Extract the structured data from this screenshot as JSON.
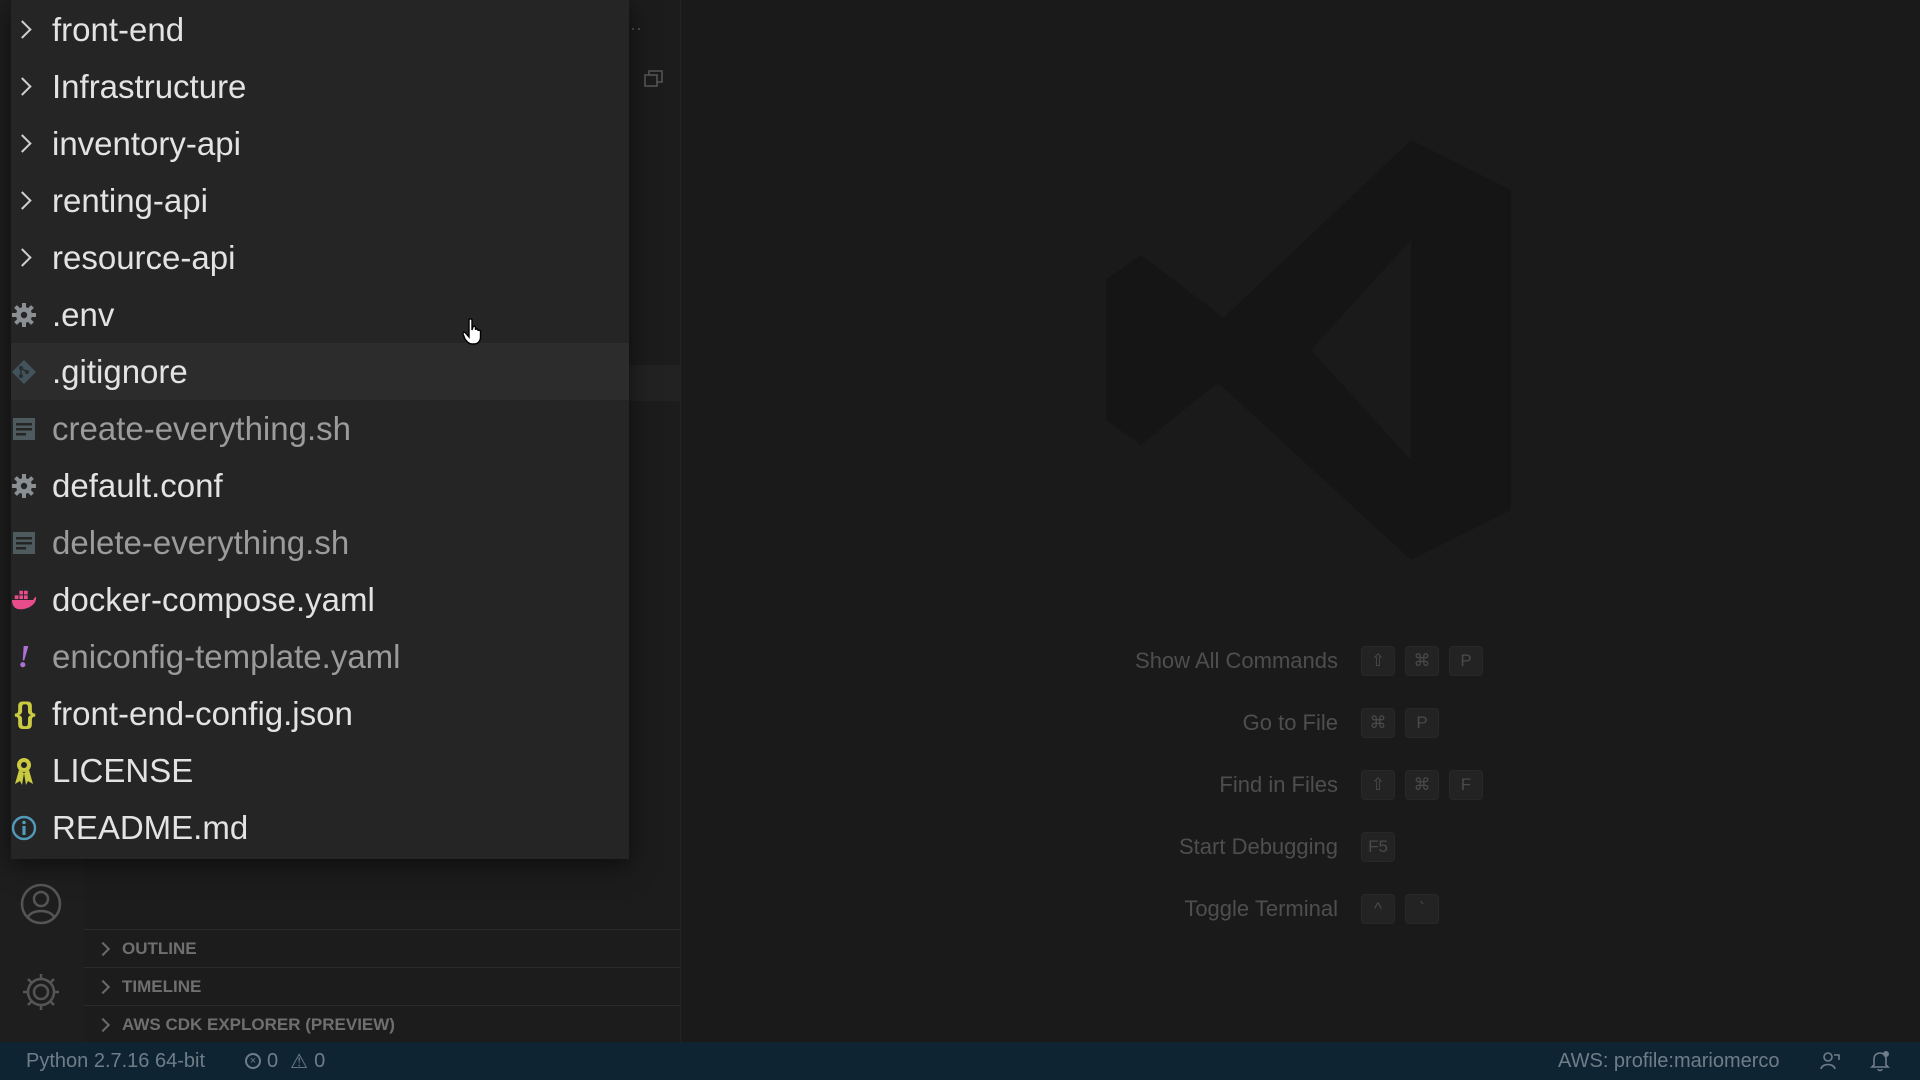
{
  "explorer": {
    "items": [
      {
        "label": "front-end",
        "kind": "folder",
        "icon": "chevron-right-icon",
        "dim": false
      },
      {
        "label": "Infrastructure",
        "kind": "folder",
        "icon": "chevron-right-icon",
        "dim": false
      },
      {
        "label": "inventory-api",
        "kind": "folder",
        "icon": "chevron-right-icon",
        "dim": false
      },
      {
        "label": "renting-api",
        "kind": "folder",
        "icon": "chevron-right-icon",
        "dim": false
      },
      {
        "label": "resource-api",
        "kind": "folder",
        "icon": "chevron-right-icon",
        "dim": false
      },
      {
        "label": ".env",
        "kind": "file",
        "icon": "gear-icon",
        "dim": false
      },
      {
        "label": ".gitignore",
        "kind": "file",
        "icon": "git-icon",
        "dim": false
      },
      {
        "label": "create-everything.sh",
        "kind": "file",
        "icon": "shell-file-icon",
        "dim": true
      },
      {
        "label": "default.conf",
        "kind": "file",
        "icon": "gear-icon",
        "dim": false
      },
      {
        "label": "delete-everything.sh",
        "kind": "file",
        "icon": "shell-file-icon",
        "dim": true
      },
      {
        "label": "docker-compose.yaml",
        "kind": "file",
        "icon": "docker-icon",
        "dim": false
      },
      {
        "label": "eniconfig-template.yaml",
        "kind": "file",
        "icon": "yaml-exclamation-icon",
        "dim": true
      },
      {
        "label": "front-end-config.json",
        "kind": "file",
        "icon": "json-braces-icon",
        "dim": false
      },
      {
        "label": "LICENSE",
        "kind": "file",
        "icon": "license-icon",
        "dim": false
      },
      {
        "label": "README.md",
        "kind": "file",
        "icon": "info-icon",
        "dim": false
      }
    ]
  },
  "sections": {
    "outline": "OUTLINE",
    "timeline": "TIMELINE",
    "cdk": "AWS CDK EXPLORER (PREVIEW)"
  },
  "watermark": {
    "commands": [
      {
        "label": "Show All Commands",
        "keys": [
          "⇧",
          "⌘",
          "P"
        ]
      },
      {
        "label": "Go to File",
        "keys": [
          "⌘",
          "P"
        ]
      },
      {
        "label": "Find in Files",
        "keys": [
          "⇧",
          "⌘",
          "F"
        ]
      },
      {
        "label": "Start Debugging",
        "keys": [
          "F5"
        ]
      },
      {
        "label": "Toggle Terminal",
        "keys": [
          "^",
          "`"
        ]
      }
    ]
  },
  "statusbar": {
    "python": "Python 2.7.16 64-bit",
    "errors": "0",
    "warnings": "0",
    "aws": "AWS: profile:mariomerco"
  },
  "colors": {
    "folder_text": "#e3e3e3",
    "dim_text": "#9b9b9b",
    "docker": "#e84c8a",
    "yaml_exclamation": "#b06fd6",
    "json_braces": "#cbcb41",
    "license": "#cbcb41",
    "info": "#519aba",
    "statusbar_bg": "#0f2433"
  }
}
